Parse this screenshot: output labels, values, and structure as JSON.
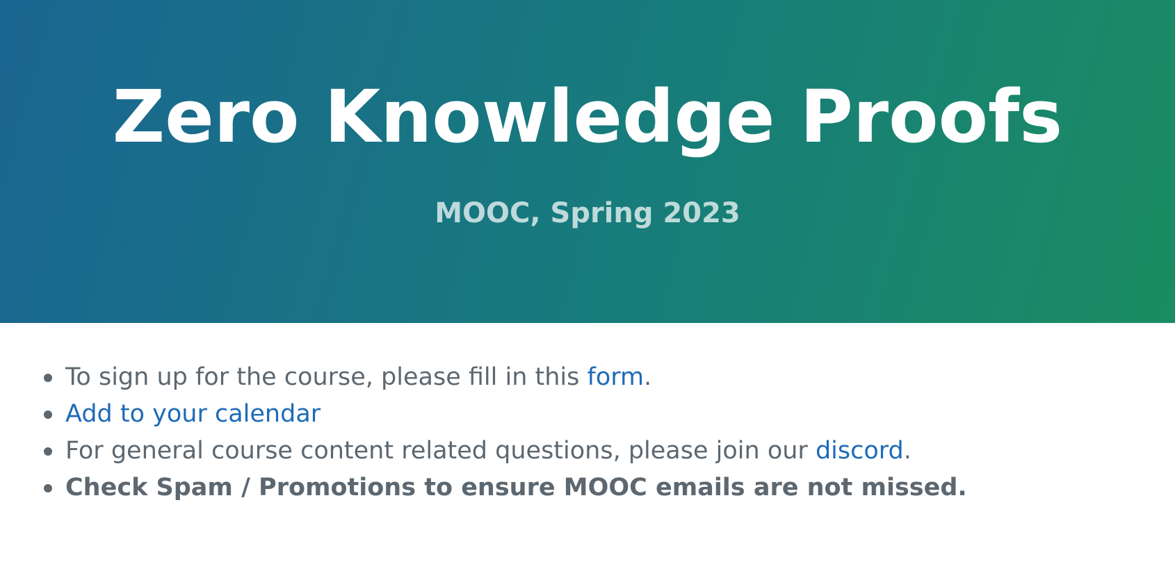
{
  "header": {
    "title": "Zero Knowledge Proofs",
    "subtitle": "MOOC, Spring 2023"
  },
  "notices": {
    "signup": {
      "text": "To sign up for the course, please fill in this ",
      "link": "form",
      "suffix": "."
    },
    "calendar": {
      "link": "Add to your calendar"
    },
    "discord": {
      "text": "For general course content related questions, please join our ",
      "link": "discord",
      "suffix": "."
    },
    "spam": {
      "text": "Check Spam / Promotions to ensure MOOC emails are not missed."
    }
  },
  "colors": {
    "gradient_start": "#1a6592",
    "gradient_end": "#1a8d62",
    "link": "#1e6bb8",
    "body_text": "#5c6770"
  }
}
